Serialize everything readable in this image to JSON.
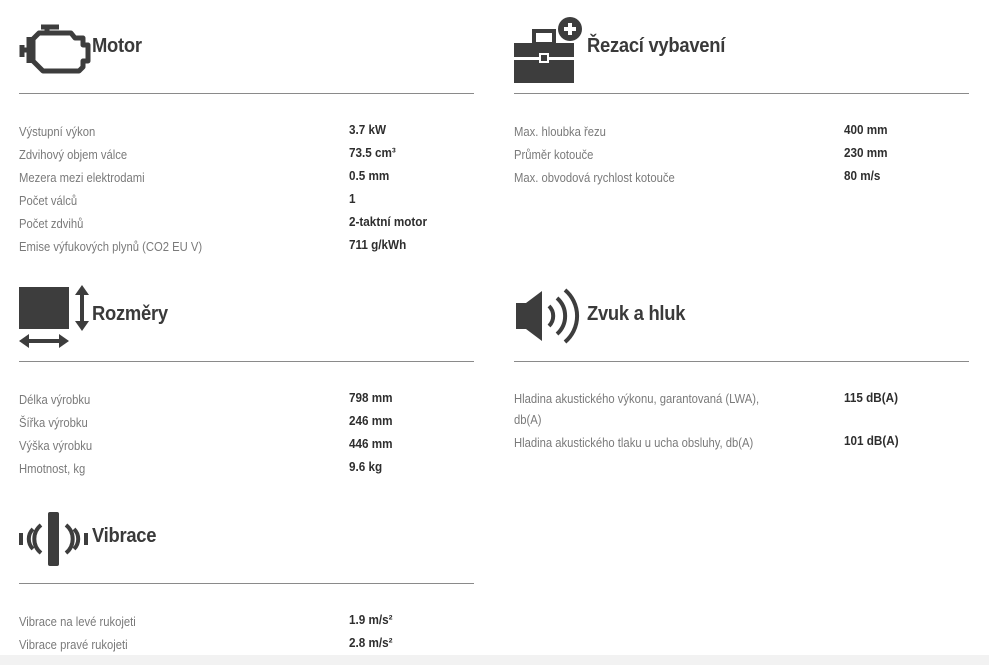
{
  "sections": {
    "motor": {
      "title": "Motor",
      "icon": "engine-icon",
      "rows": [
        {
          "label": "Výstupní výkon",
          "value": "3.7 kW"
        },
        {
          "label": "Zdvihový objem válce",
          "value": "73.5 cm³"
        },
        {
          "label": "Mezera mezi elektrodami",
          "value": "0.5 mm"
        },
        {
          "label": "Počet válců",
          "value": "1"
        },
        {
          "label": "Počet zdvihů",
          "value": "2-taktní motor"
        },
        {
          "label": "Emise výfukových plynů (CO2 EU V)",
          "value": "711 g/kWh"
        }
      ]
    },
    "cutting": {
      "title": "Řezací vybavení",
      "icon": "toolbox-plus-icon",
      "rows": [
        {
          "label": "Max. hloubka řezu",
          "value": "400 mm"
        },
        {
          "label": "Průměr kotouče",
          "value": "230 mm"
        },
        {
          "label": "Max. obvodová rychlost kotouče",
          "value": "80 m/s"
        }
      ]
    },
    "dimensions": {
      "title": "Rozměry",
      "icon": "dimensions-icon",
      "rows": [
        {
          "label": "Délka výrobku",
          "value": "798 mm"
        },
        {
          "label": "Šířka výrobku",
          "value": "246 mm"
        },
        {
          "label": "Výška výrobku",
          "value": "446 mm"
        },
        {
          "label": "Hmotnost, kg",
          "value": "9.6 kg"
        }
      ]
    },
    "sound": {
      "title": "Zvuk a hluk",
      "icon": "speaker-icon",
      "rows": [
        {
          "label": "Hladina akustického výkonu, garantovaná (LWA), db(A)",
          "value": "115 dB(A)"
        },
        {
          "label": "Hladina akustického tlaku u ucha obsluhy, db(A)",
          "value": "101 dB(A)"
        }
      ]
    },
    "vibration": {
      "title": "Vibrace",
      "icon": "vibration-icon",
      "rows": [
        {
          "label": "Vibrace na levé rukojeti",
          "value": "1.9 m/s²"
        },
        {
          "label": "Vibrace pravé rukojeti",
          "value": "2.8 m/s²"
        }
      ]
    }
  },
  "colors": {
    "icon": "#3d3d3d",
    "rule": "#8a8a8a",
    "label": "#7a7a7a",
    "value": "#2e2e2e"
  }
}
